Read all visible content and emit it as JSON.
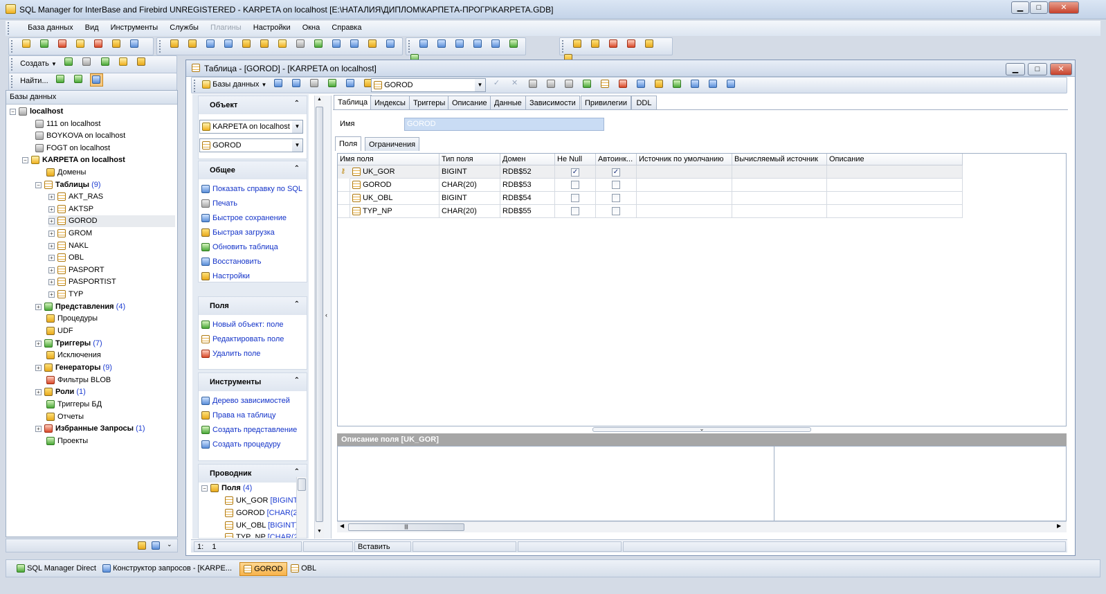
{
  "window": {
    "title": "SQL Manager for InterBase and Firebird UNREGISTERED - KARPETA on localhost [E:\\НАТАЛИЯ\\ДИПЛОМ\\КАРПЕТА-ПРОГР\\KARPETA.GDB]",
    "min": "▁",
    "max": "□",
    "close": "✕"
  },
  "menu": {
    "items": [
      "База данных",
      "Вид",
      "Инструменты",
      "Службы",
      "Плагины",
      "Настройки",
      "Окна",
      "Справка"
    ],
    "disabled_index": 4
  },
  "toolbar2": {
    "create_label": "Создать",
    "find_label": "Найти..."
  },
  "left_panel": {
    "title": "Базы данных",
    "nodes": {
      "localhost": "localhost",
      "db1": "111 on localhost",
      "db2": "BOYKOVA on localhost",
      "db3": "FOGT on localhost",
      "db4": "KARPETA on localhost",
      "domains": "Домены",
      "tables": "Таблицы",
      "tables_count": "(9)",
      "t1": "AKT_RAS",
      "t2": "AKTSP",
      "t3": "GOROD",
      "t4": "GROM",
      "t5": "NAKL",
      "t6": "OBL",
      "t7": "PASPORT",
      "t8": "PASPORTIST",
      "t9": "TYP",
      "views": "Представления",
      "views_count": "(4)",
      "procs": "Процедуры",
      "udf": "UDF",
      "triggers": "Триггеры",
      "triggers_count": "(7)",
      "exceptions": "Исключения",
      "generators": "Генераторы",
      "generators_count": "(9)",
      "blob": "Фильтры BLOB",
      "roles": "Роли",
      "roles_count": "(1)",
      "dbtriggers": "Триггеры БД",
      "reports": "Отчеты",
      "fav": "Избранные Запросы",
      "fav_count": "(1)",
      "projects": "Проекты"
    }
  },
  "doc": {
    "title": "Таблица - [GOROD] - [KARPETA on localhost]",
    "toolbar_db": "Базы данных",
    "toolbar_combo": "GOROD"
  },
  "nav": {
    "object_h": "Объект",
    "db_combo": "KARPETA on localhost",
    "table_combo": "GOROD",
    "general_h": "Общее",
    "general": [
      "Показать справку по SQL",
      "Печать",
      "Быстрое сохранение",
      "Быстрая загрузка",
      "Обновить таблица",
      "Восстановить",
      "Настройки"
    ],
    "fields_h": "Поля",
    "fields": [
      "Новый объект: поле",
      "Редактировать поле",
      "Удалить поле"
    ],
    "tools_h": "Инструменты",
    "tools": [
      "Дерево зависимостей",
      "Права на таблицу",
      "Создать представление",
      "Создать процедуру"
    ],
    "explorer_h": "Проводник",
    "exp_root": "Поля",
    "exp_root_count": "(4)",
    "exp": [
      {
        "name": "UK_GOR",
        "type": "[BIGINT]"
      },
      {
        "name": "GOROD",
        "type": "[CHAR(2"
      },
      {
        "name": "UK_OBL",
        "type": "[BIGINT]"
      },
      {
        "name": "TYP_NP",
        "type": "[CHAR(2"
      }
    ]
  },
  "tabs": [
    "Таблица",
    "Индексы",
    "Триггеры",
    "Описание",
    "Данные",
    "Зависимости",
    "Привилегии",
    "DDL"
  ],
  "name_label": "Имя",
  "name_value": "GOROD",
  "subtabs": [
    "Поля",
    "Ограничения"
  ],
  "grid": {
    "headers": [
      "Имя поля",
      "Тип поля",
      "Домен",
      "Не Null",
      "Автоинк...",
      "Источник по умолчанию",
      "Вычисляемый источник",
      "Описание"
    ],
    "rows": [
      {
        "name": "UK_GOR",
        "type": "BIGINT",
        "domain": "RDB$52",
        "notnull": true,
        "autoinc": true
      },
      {
        "name": "GOROD",
        "type": "CHAR(20)",
        "domain": "RDB$53",
        "notnull": false,
        "autoinc": false
      },
      {
        "name": "UK_OBL",
        "type": "BIGINT",
        "domain": "RDB$54",
        "notnull": false,
        "autoinc": false
      },
      {
        "name": "TYP_NP",
        "type": "CHAR(20)",
        "domain": "RDB$55",
        "notnull": false,
        "autoinc": false
      }
    ]
  },
  "desc_title": "Описание поля [UK_GOR]",
  "status": {
    "pos1": "1:",
    "pos2": "1",
    "mode": "Вставить"
  },
  "taskbar": [
    "SQL Manager Direct",
    "Конструктор запросов - [KARPE...",
    "GOROD",
    "OBL"
  ],
  "icons": {
    "check": "✓",
    "key": "key-icon",
    "up": "▲",
    "down": "▼"
  },
  "colors": {
    "accent": "#f7b24a",
    "link": "#1232c8",
    "count": "#1b3bd1"
  }
}
